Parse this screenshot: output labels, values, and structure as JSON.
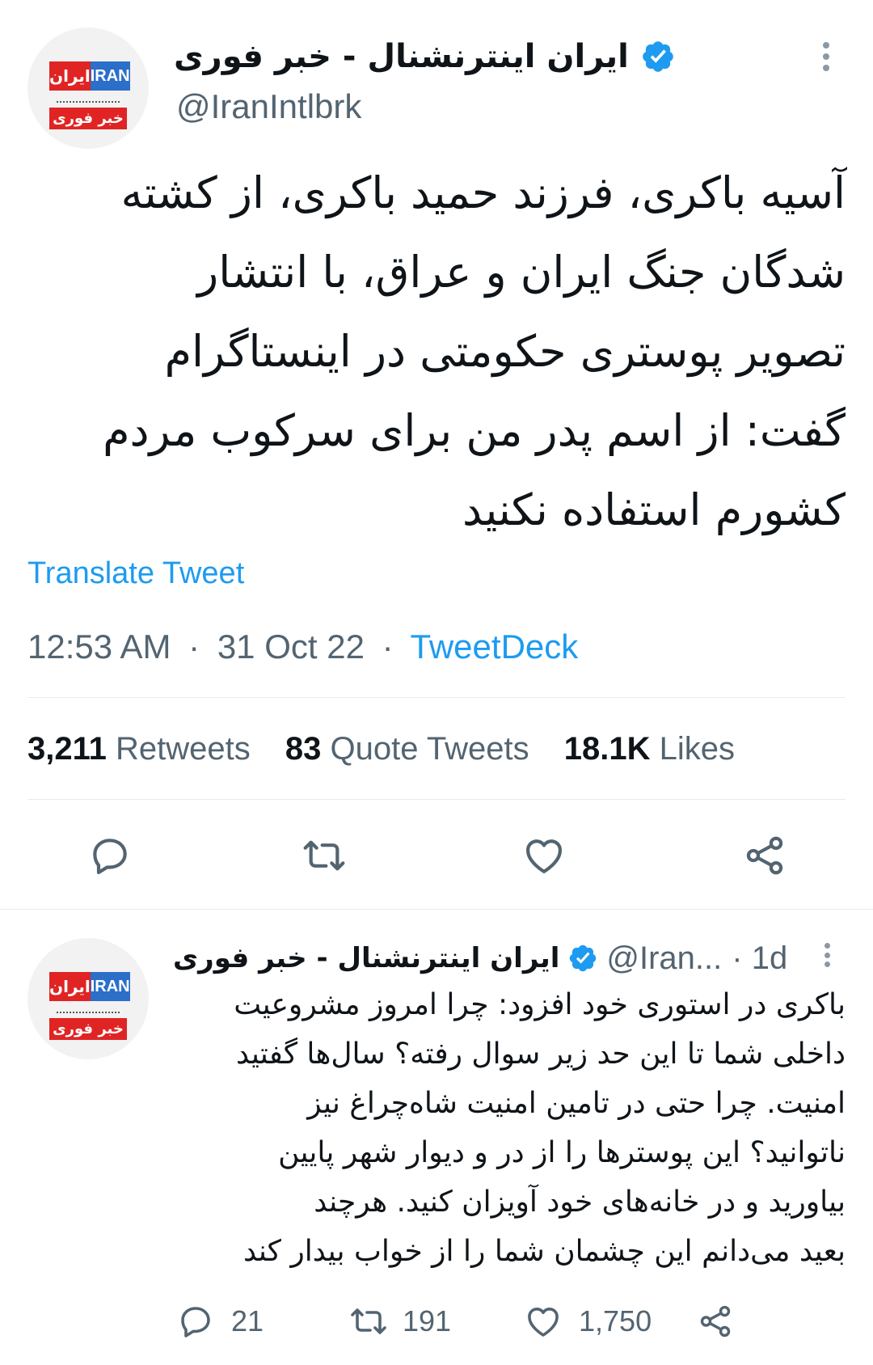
{
  "main_tweet": {
    "avatar": {
      "logo_fa": "ایران",
      "logo_en": "IRAN",
      "logo_sub": "اینترنشنال",
      "logo_badge": "خبر فوری"
    },
    "display_name": "ایران اینترنشنال - خبر فوری",
    "handle": "@IranIntlbrk",
    "text": "آسیه باکری، فرزند حمید باکری، از کشته\nشدگان جنگ ایران و عراق، با انتشار\nتصویر پوستری حکومتی در اینستاگرام\nگفت: از اسم پدر من برای سرکوب مردم\nکشورم استفاده نکنید",
    "translate_label": "Translate Tweet",
    "time": "12:53 AM",
    "date": "31 Oct 22",
    "source": "TweetDeck",
    "separator": "·",
    "retweets_count": "3,211",
    "retweets_label": "Retweets",
    "quotes_count": "83",
    "quotes_label": "Quote Tweets",
    "likes_count": "18.1K",
    "likes_label": "Likes",
    "icons": [
      "more-icon",
      "verified-icon",
      "reply-icon",
      "retweet-icon",
      "like-icon",
      "share-icon"
    ]
  },
  "reply_tweet": {
    "display_name": "ایران اینترنشنال - خبر فوری",
    "handle": "@Iran...",
    "time": "· 1d",
    "text": "باکری در استوری خود افزود: چرا امروز مشروعیت\nداخلی شما تا این حد زیر سوال رفته؟ سال‌ها گفتید\nامنیت. چرا حتی در تامین امنیت شاه‌چراغ نیز\nناتوانید؟ این پوسترها را از در و دیوار شهر پایین\nبیاورید و در خانه‌های خود آویزان کنید. هرچند\nبعید می‌دانم این چشمان شما را از خواب بیدار کند",
    "reply_count": "21",
    "retweet_count": "191",
    "like_count": "1,750"
  },
  "colors": {
    "accent": "#1d9bf0",
    "secondary_text": "#536471",
    "primary_text": "#0f1419",
    "divider": "#e6ecf0",
    "logo_red": "#e02424",
    "logo_blue": "#2b6fc9"
  }
}
